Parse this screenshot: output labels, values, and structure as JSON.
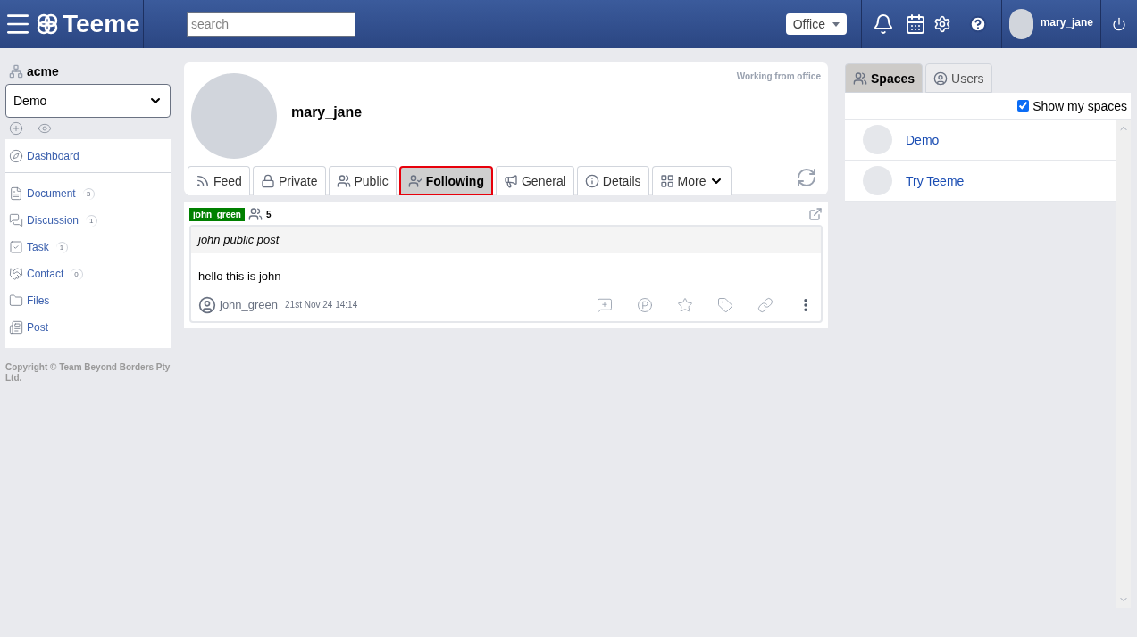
{
  "header": {
    "logo": "Teeme",
    "search": {
      "placeholder": "search"
    },
    "location": "Office",
    "user": "mary_jane"
  },
  "sidebar": {
    "org": "acme",
    "space_select": "Demo",
    "items": [
      {
        "label": "Dashboard"
      },
      {
        "label": "Document",
        "count": "3"
      },
      {
        "label": "Discussion",
        "count": "1"
      },
      {
        "label": "Task",
        "count": "1"
      },
      {
        "label": "Contact",
        "count": "0"
      },
      {
        "label": "Files"
      },
      {
        "label": "Post"
      }
    ],
    "copyright": "Copyright © Team Beyond Borders Pty Ltd."
  },
  "profile": {
    "name": "mary_jane",
    "status": "Working from office",
    "tabs": [
      {
        "label": "Feed",
        "selected": false
      },
      {
        "label": "Private",
        "selected": false
      },
      {
        "label": "Public",
        "selected": false
      },
      {
        "label": "Following",
        "selected": true
      },
      {
        "label": "General",
        "selected": false
      },
      {
        "label": "Details",
        "selected": false
      },
      {
        "label": "More",
        "selected": false
      }
    ]
  },
  "post": {
    "tag": "john_green",
    "members": "5",
    "title": "john public post",
    "body": "hello this is john",
    "author": "john_green",
    "time": "21st Nov 24 14:14"
  },
  "right": {
    "tabs": [
      {
        "label": "Spaces",
        "selected": true
      },
      {
        "label": "Users",
        "selected": false
      }
    ],
    "show_my_spaces": {
      "label": "Show my spaces",
      "checked": true
    },
    "spaces": [
      {
        "name": "Demo"
      },
      {
        "name": "Try Teeme"
      }
    ]
  }
}
